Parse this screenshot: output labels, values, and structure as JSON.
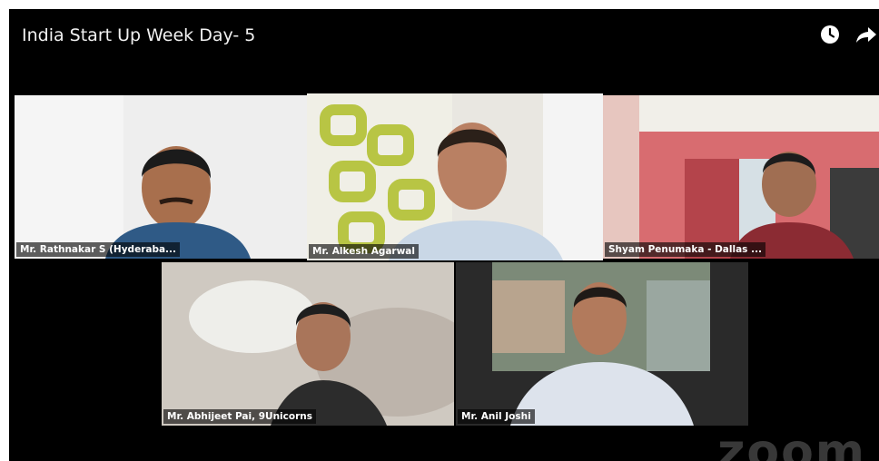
{
  "header": {
    "title": "India Start Up Week Day- 5"
  },
  "icons": {
    "watch_later": "clock-icon",
    "share": "share-icon"
  },
  "participants": [
    {
      "name": "Mr. Rathnakar S (Hyderaba..."
    },
    {
      "name": "Mr. Alkesh Agarwal",
      "active_speaker": true
    },
    {
      "name": "Shyam Penumaka - Dallas ..."
    },
    {
      "name": "Mr. Abhijeet Pai, 9Unicorns"
    },
    {
      "name": "Mr. Anil Joshi"
    }
  ],
  "watermark": "zoom",
  "colors": {
    "active_border": "#6bd12f",
    "background": "#000000"
  }
}
